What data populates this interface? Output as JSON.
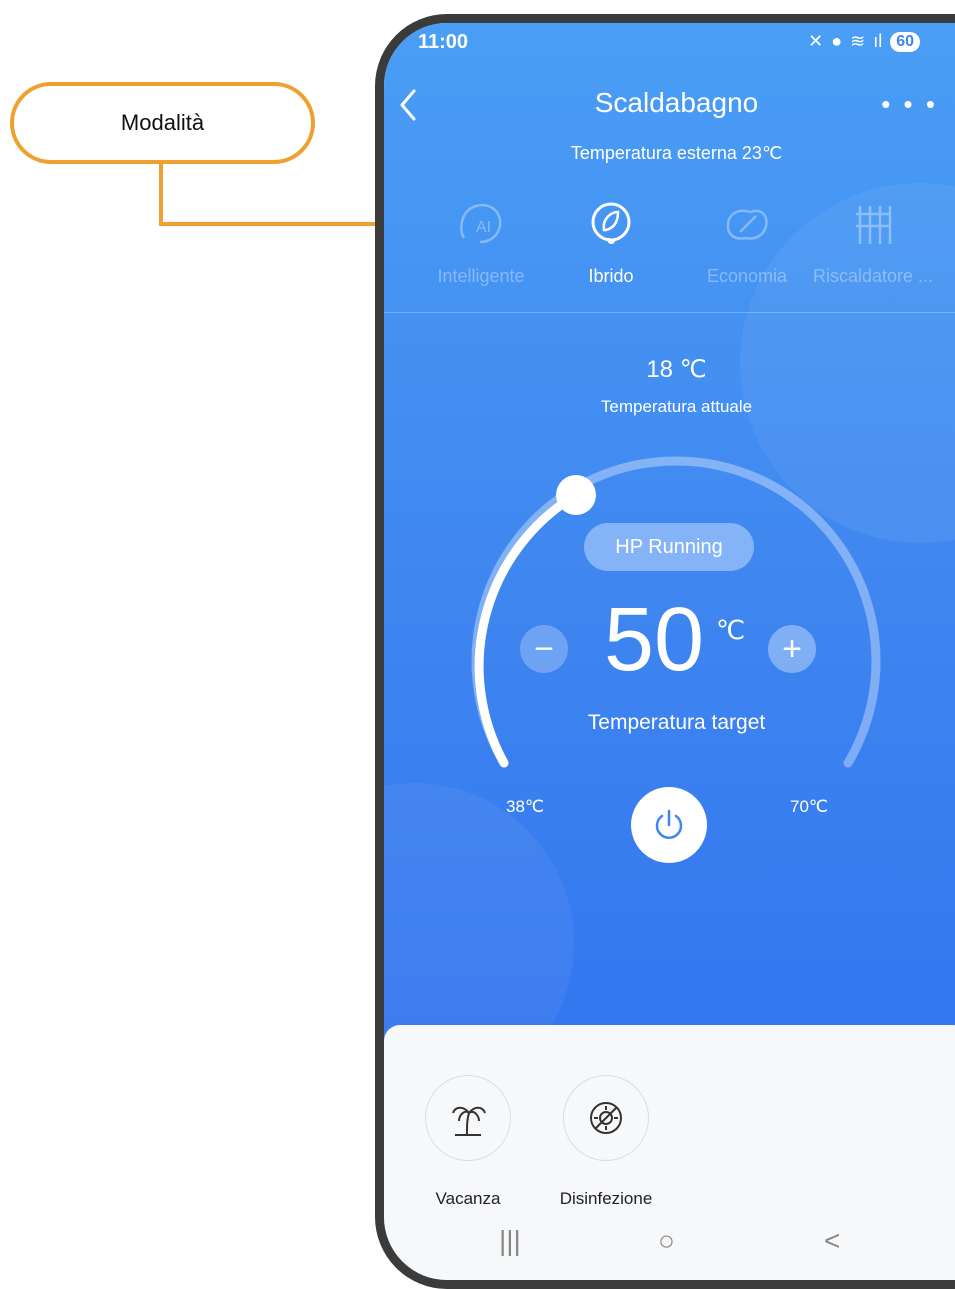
{
  "callout": {
    "label": "Modalità",
    "color": "#f0a030"
  },
  "status_bar": {
    "time": "11:00",
    "battery": "60"
  },
  "header": {
    "title": "Scaldabagno",
    "outside_temp": "Temperatura esterna 23℃",
    "more_label": "• • •"
  },
  "modes": [
    {
      "label": "Intelligente",
      "icon": "ai-icon",
      "active": false
    },
    {
      "label": "Ibrido",
      "icon": "hybrid-leaf-icon",
      "active": true
    },
    {
      "label": "Economia",
      "icon": "eco-leaf-icon",
      "active": false
    },
    {
      "label": "Riscaldatore ...",
      "icon": "heater-icon",
      "active": false
    }
  ],
  "current": {
    "value": "18 ℃",
    "label": "Temperatura attuale"
  },
  "thermostat": {
    "status": "HP Running",
    "target": "50",
    "unit": "℃",
    "target_label": "Temperatura target",
    "min": "38℃",
    "max": "70℃",
    "minus": "−",
    "plus": "+"
  },
  "functions": [
    {
      "label": "Vacanza",
      "icon": "palm-tree-icon"
    },
    {
      "label": "Disinfezione",
      "icon": "disinfection-icon"
    }
  ],
  "nav": {
    "recent": "|||",
    "home": "○",
    "back": "<"
  },
  "colors": {
    "primary": "#3f86f0",
    "accent": "#f0a030"
  }
}
